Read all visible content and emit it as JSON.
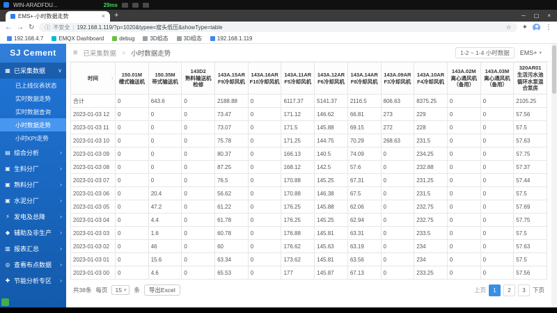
{
  "remote_bar": {
    "title": "WIN-ARADFDU...",
    "latency": "29ms"
  },
  "browser": {
    "tab_title": "EMS+·小时数据走势",
    "security_label": "不安全",
    "address": "192.168.1.119/?p=1020&typee=窑头低压&showType=table",
    "bookmarks": [
      {
        "label": "192.168.4.7",
        "color": "#4285f4"
      },
      {
        "label": "EMQX Dashboard",
        "color": "#00bcd4"
      },
      {
        "label": "debug",
        "color": "#67c23a"
      },
      {
        "label": "3D组态",
        "color": "#9aa0a6"
      },
      {
        "label": "3D组态",
        "color": "#9aa0a6"
      },
      {
        "label": "192.168.1.119",
        "color": "#4285f4"
      }
    ]
  },
  "sidebar": {
    "logo": "SJ Cement",
    "sections": [
      {
        "label": "已采集数据",
        "glyph": "▦",
        "active": true,
        "expanded": true,
        "children": [
          {
            "label": "已上线仪表状态",
            "active": false
          },
          {
            "label": "实时数据走势",
            "active": false
          },
          {
            "label": "实时数据查询",
            "active": false
          },
          {
            "label": "小时数据走势",
            "active": true
          },
          {
            "label": "小时KPI走势",
            "active": false
          }
        ]
      },
      {
        "label": "综合分析",
        "glyph": "▤"
      },
      {
        "label": "生料分厂",
        "glyph": "▣"
      },
      {
        "label": "熟料分厂",
        "glyph": "▣"
      },
      {
        "label": "水泥分厂",
        "glyph": "▣"
      },
      {
        "label": "发电及总降",
        "glyph": "⚡"
      },
      {
        "label": "辅助及非生产",
        "glyph": "◆"
      },
      {
        "label": "报表汇总",
        "glyph": "▥"
      },
      {
        "label": "查看布点数据",
        "glyph": "◎"
      },
      {
        "label": "节能分析专区",
        "glyph": "✚"
      }
    ]
  },
  "header": {
    "breadcrumb": {
      "parent": "已采集数据",
      "sep": ">",
      "current": "小时数据走势"
    },
    "range_label": "1-2 ~ 1-4 小时数据",
    "profile_label": "EMS+"
  },
  "table": {
    "columns": [
      {
        "code": "",
        "name": "时间"
      },
      {
        "code": "150.01M",
        "name": "槽式输送机"
      },
      {
        "code": "150.35M",
        "name": "带式输送机"
      },
      {
        "code": "143D2",
        "name": "熟料输送机检修"
      },
      {
        "code": "143A.15AR",
        "name": "F9冷却风机"
      },
      {
        "code": "143A.16AR",
        "name": "F10冷却风机"
      },
      {
        "code": "143A.11AR",
        "name": "F5冷却风机"
      },
      {
        "code": "143A.12AR",
        "name": "F6冷却风机"
      },
      {
        "code": "143A.14AR",
        "name": "F8冷却风机"
      },
      {
        "code": "143A.09AR",
        "name": "F3冷却风机"
      },
      {
        "code": "143A.10AR",
        "name": "F4冷却风机"
      },
      {
        "code": "143A.02M",
        "name": "离心通风机（备用）"
      },
      {
        "code": "143A.03M",
        "name": "离心通风机（备用）"
      },
      {
        "code": "320AR01",
        "name": "生活污水池循环水泵混合泵房"
      }
    ],
    "rows": [
      {
        "time": "合计",
        "values": [
          "0",
          "643.6",
          "0",
          "2188.88",
          "0",
          "6117.37",
          "5141.37",
          "2116.5",
          "806.63",
          "8375.25",
          "0",
          "0",
          "2105.25"
        ]
      },
      {
        "time": "2023-01-03 12",
        "values": [
          "0",
          "0",
          "0",
          "73.47",
          "0",
          "171.12",
          "146.62",
          "66.81",
          "273",
          "229",
          "0",
          "0",
          "57.56"
        ]
      },
      {
        "time": "2023-01-03 11",
        "values": [
          "0",
          "0",
          "0",
          "73.07",
          "0",
          "171.5",
          "145.88",
          "69.15",
          "272",
          "228",
          "0",
          "0",
          "57.5"
        ]
      },
      {
        "time": "2023-01-03 10",
        "values": [
          "0",
          "0",
          "0",
          "75.78",
          "0",
          "171.25",
          "144.75",
          "70.29",
          "268.63",
          "231.5",
          "0",
          "0",
          "57.63"
        ]
      },
      {
        "time": "2023-01-03 09",
        "values": [
          "0",
          "0",
          "0",
          "80.37",
          "0",
          "166.13",
          "140.5",
          "74.09",
          "0",
          "234.25",
          "0",
          "0",
          "57.75"
        ]
      },
      {
        "time": "2023-01-03 08",
        "values": [
          "0",
          "0",
          "0",
          "87.25",
          "0",
          "168.12",
          "142.5",
          "57.6",
          "0",
          "232.88",
          "0",
          "0",
          "57.37"
        ]
      },
      {
        "time": "2023-01-03 07",
        "values": [
          "0",
          "0",
          "0",
          "76.5",
          "0",
          "170.88",
          "145.25",
          "67.31",
          "0",
          "231.25",
          "0",
          "0",
          "57.44"
        ]
      },
      {
        "time": "2023-01-03 06",
        "values": [
          "0",
          "20.4",
          "0",
          "56.62",
          "0",
          "170.88",
          "146.38",
          "67.5",
          "0",
          "231.5",
          "0",
          "0",
          "57.5"
        ]
      },
      {
        "time": "2023-01-03 05",
        "values": [
          "0",
          "47.2",
          "0",
          "61.22",
          "0",
          "176.25",
          "145.88",
          "62.06",
          "0",
          "232.75",
          "0",
          "0",
          "57.69"
        ]
      },
      {
        "time": "2023-01-03 04",
        "values": [
          "0",
          "4.4",
          "0",
          "61.78",
          "0",
          "176.25",
          "145.25",
          "62.94",
          "0",
          "232.75",
          "0",
          "0",
          "57.75"
        ]
      },
      {
        "time": "2023-01-03 03",
        "values": [
          "0",
          "1.6",
          "0",
          "60.78",
          "0",
          "176.88",
          "145.81",
          "63.31",
          "0",
          "233.5",
          "0",
          "0",
          "57.5"
        ]
      },
      {
        "time": "2023-01-03 02",
        "values": [
          "0",
          "46",
          "0",
          "60",
          "0",
          "176.62",
          "145.63",
          "63.19",
          "0",
          "234",
          "0",
          "0",
          "57.63"
        ]
      },
      {
        "time": "2023-01-03 01",
        "values": [
          "0",
          "15.6",
          "0",
          "63.34",
          "0",
          "173.62",
          "145.81",
          "63.56",
          "0",
          "234",
          "0",
          "0",
          "57.5"
        ]
      },
      {
        "time": "2023-01-03 00",
        "values": [
          "0",
          "4.6",
          "0",
          "65.53",
          "0",
          "177",
          "145.87",
          "67.13",
          "0",
          "233.25",
          "0",
          "0",
          "57.56"
        ]
      }
    ]
  },
  "footer": {
    "total_label": "共38条",
    "per_page_label": "每页",
    "page_size": "15",
    "unit_label": "条",
    "export_label": "导出Excel",
    "pagination": {
      "prev_label": "上页",
      "next_label": "下页",
      "pages": [
        "1",
        "2",
        "3"
      ],
      "active_page": "1"
    }
  },
  "icons": {
    "back": "←",
    "forward": "→",
    "refresh": "↻",
    "info": "ⓘ",
    "star": "☆",
    "extensions": "✦",
    "menu": "⋮",
    "new_tab": "+",
    "minimize": "─",
    "maximize": "▢",
    "close": "×",
    "tab_close": "×",
    "hamburger": "≡",
    "caret_down": "▾",
    "sort": "↕"
  },
  "colors": {
    "sidebar_top": "#2176d9",
    "sidebar_bottom": "#135aab",
    "active_item": "#4796ef",
    "accent_blue": "#3a8ee6",
    "latency_green": "#3ed65c"
  }
}
